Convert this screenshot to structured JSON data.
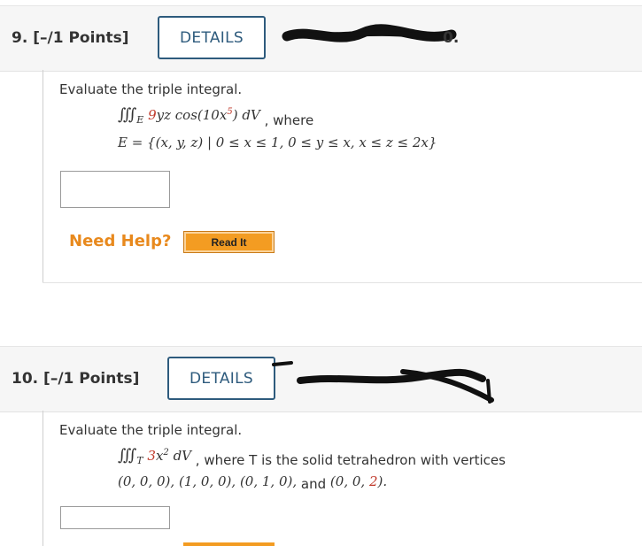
{
  "questions": [
    {
      "number": "9.",
      "points": "[–/1 Points]",
      "details_label": "DETAILS",
      "prompt": "Evaluate the triple integral.",
      "integral_prefix": "∭",
      "integral_sub": "E",
      "integrand_coef": "9",
      "integrand_rest": "yz cos(10x",
      "integrand_exp": "5",
      "integrand_close": ")",
      "integrand_dv": "dV",
      "where_text": ", where",
      "region": "E = {(x, y, z) | 0 ≤ x ≤ 1, 0 ≤ y ≤ x, x ≤ z ≤ 2x}",
      "answer_value": "",
      "need_help": "Need Help?",
      "read_it": "Read It"
    },
    {
      "number": "10.",
      "points": "[–/1 Points]",
      "details_label": "DETAILS",
      "prompt": "Evaluate the triple integral.",
      "integral_prefix": "∭",
      "integral_sub": "T",
      "integrand_coef": "3",
      "integrand_rest": "x",
      "integrand_exp": "2",
      "integrand_dv": "dV",
      "where_text": ", where T is the solid tetrahedron with vertices",
      "vertices_a": "(0, 0, 0),",
      "vertices_b": "(1, 0, 0),",
      "vertices_c": "(0, 1, 0),",
      "and_text": "and",
      "vertices_d_open": "(0, 0, ",
      "vertices_d_red": "2",
      "vertices_d_close": ").",
      "answer_value": ""
    }
  ],
  "colors": {
    "accent": "#2e5b7d",
    "highlight": "#c0392b",
    "help": "#e8891d",
    "read_button": "#f39c22"
  }
}
